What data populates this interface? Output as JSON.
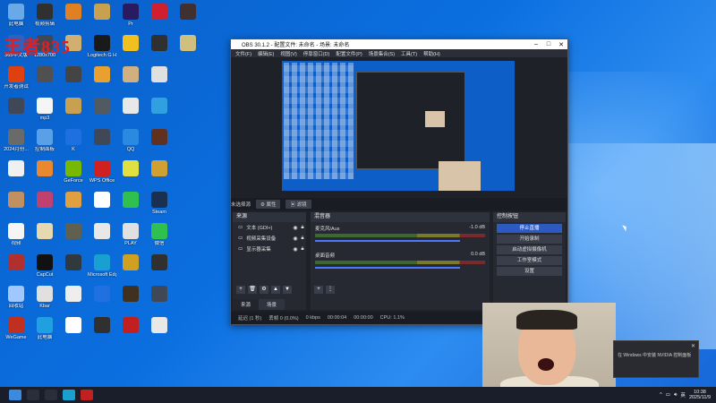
{
  "watermark": "王者835",
  "desktop_icons": [
    {
      "label": "此电脑",
      "color": "#6aa9e8"
    },
    {
      "label": "365中文版",
      "color": "#3060c0"
    },
    {
      "label": "开发者测试",
      "color": "#e04010"
    },
    {
      "label": "",
      "color": "#404858"
    },
    {
      "label": "2024月份...",
      "color": "#6a6a6a"
    },
    {
      "label": "",
      "color": "#f0f0f0"
    },
    {
      "label": "",
      "color": "#c09060"
    },
    {
      "label": "视频",
      "color": "#f5f5f5"
    },
    {
      "label": "",
      "color": "#b03030"
    },
    {
      "label": "回收站",
      "color": "#a0c8ff"
    },
    {
      "label": "WeGame",
      "color": "#c03020"
    },
    {
      "label": "视频剪辑",
      "color": "#303030"
    },
    {
      "label": "1280x700",
      "color": "#404858"
    },
    {
      "label": "",
      "color": "#505050"
    },
    {
      "label": "mp3",
      "color": "#f5f5f5"
    },
    {
      "label": "控制面板",
      "color": "#5aa0e8"
    },
    {
      "label": "",
      "color": "#e88830"
    },
    {
      "label": "",
      "color": "#c04070"
    },
    {
      "label": "",
      "color": "#e6d8b0"
    },
    {
      "label": "CapCut",
      "color": "#111111"
    },
    {
      "label": "Kbar",
      "color": "#e0e0e0"
    },
    {
      "label": "此电脑",
      "color": "#20a0e0"
    },
    {
      "label": "",
      "color": "#e08020"
    },
    {
      "label": "",
      "color": "#d0b070"
    },
    {
      "label": "",
      "color": "#444444"
    },
    {
      "label": "",
      "color": "#c8a050"
    },
    {
      "label": "K",
      "color": "#1e70e0"
    },
    {
      "label": "GeForce",
      "color": "#76b900"
    },
    {
      "label": "",
      "color": "#e0a040"
    },
    {
      "label": "",
      "color": "#606050"
    },
    {
      "label": "",
      "color": "#303840"
    },
    {
      "label": "",
      "color": "#eeeeee"
    },
    {
      "label": "",
      "color": "#ffffff"
    },
    {
      "label": "",
      "color": "#c8a050"
    },
    {
      "label": "Logitech G HUB",
      "color": "#1a1a1a"
    },
    {
      "label": "",
      "color": "#e8a030"
    },
    {
      "label": "",
      "color": "#505a60"
    },
    {
      "label": "",
      "color": "#404858"
    },
    {
      "label": "WPS Office",
      "color": "#d02020"
    },
    {
      "label": "",
      "color": "#ffffff"
    },
    {
      "label": "",
      "color": "#e8e8e8"
    },
    {
      "label": "Microsoft Edge",
      "color": "#1aa0d0"
    },
    {
      "label": "",
      "color": "#2070e0"
    },
    {
      "label": "",
      "color": "#303030"
    },
    {
      "label": "Pr",
      "color": "#2a1a60"
    },
    {
      "label": "",
      "color": "#f0c020"
    },
    {
      "label": "",
      "color": "#d0b080"
    },
    {
      "label": "",
      "color": "#e8e8e8"
    },
    {
      "label": "QQ",
      "color": "#2a8ae0"
    },
    {
      "label": "",
      "color": "#e0e040"
    },
    {
      "label": "",
      "color": "#30c050"
    },
    {
      "label": "PLAY",
      "color": "#e0e0e0"
    },
    {
      "label": "",
      "color": "#d0a020"
    },
    {
      "label": "",
      "color": "#403020"
    },
    {
      "label": "",
      "color": "#c02020"
    },
    {
      "label": "",
      "color": "#d02030"
    },
    {
      "label": "",
      "color": "#303030"
    },
    {
      "label": "",
      "color": "#e0e0e0"
    },
    {
      "label": "",
      "color": "#30a0e0"
    },
    {
      "label": "",
      "color": "#603020"
    },
    {
      "label": "",
      "color": "#d0a030"
    },
    {
      "label": "Steam",
      "color": "#1a3050"
    },
    {
      "label": "微信",
      "color": "#30c050"
    },
    {
      "label": "",
      "color": "#303030"
    },
    {
      "label": "",
      "color": "#404858"
    },
    {
      "label": "",
      "color": "#e8e8e8"
    },
    {
      "label": "",
      "color": "#403030"
    },
    {
      "label": "",
      "color": "#d0c080"
    }
  ],
  "obs": {
    "title": "OBS 30.1.2 - 配置文件: 未命名 - 场景: 未命名",
    "menu": [
      "文件(F)",
      "编辑(E)",
      "视图(V)",
      "停靠窗口(D)",
      "配置文件(P)",
      "场景集合(S)",
      "工具(T)",
      "帮助(H)"
    ],
    "no_source": "未选择源",
    "props_btn": "⚙ 属性",
    "filters_btn": "▣ 滤镜",
    "sources_title": "来源",
    "sources": [
      "文本 (GDI+)",
      "视频采集设备",
      "显示器采集"
    ],
    "mixer_title": "混音器",
    "mixer": [
      {
        "name": "麦克风/Aux",
        "db": "-1.0 dB"
      },
      {
        "name": "桌面音频",
        "db": "0.0 dB"
      }
    ],
    "controls_title": "控制按钮",
    "controls": [
      "停止直播",
      "开始录制",
      "启动虚拟摄像机",
      "工作室模式",
      "设置"
    ],
    "tabs": [
      "来源",
      "场景"
    ],
    "status": {
      "delay": "延迟 (1 秒)",
      "dropped": "丢帧 0 (0.0%)",
      "bitrate": "0 kbps",
      "live": "00:00:04",
      "rec": "00:00:00",
      "cpu": "CPU: 1.1%"
    }
  },
  "notification": {
    "text": "在 Windows 中安装 NVIDIA 控制面板"
  },
  "taskbar": {
    "items": [
      "windows-icon",
      "search-icon",
      "task-view-icon",
      "edge-icon",
      "obs-icon"
    ],
    "lang": "英",
    "time": "10:38",
    "date": "2025/11/9"
  }
}
